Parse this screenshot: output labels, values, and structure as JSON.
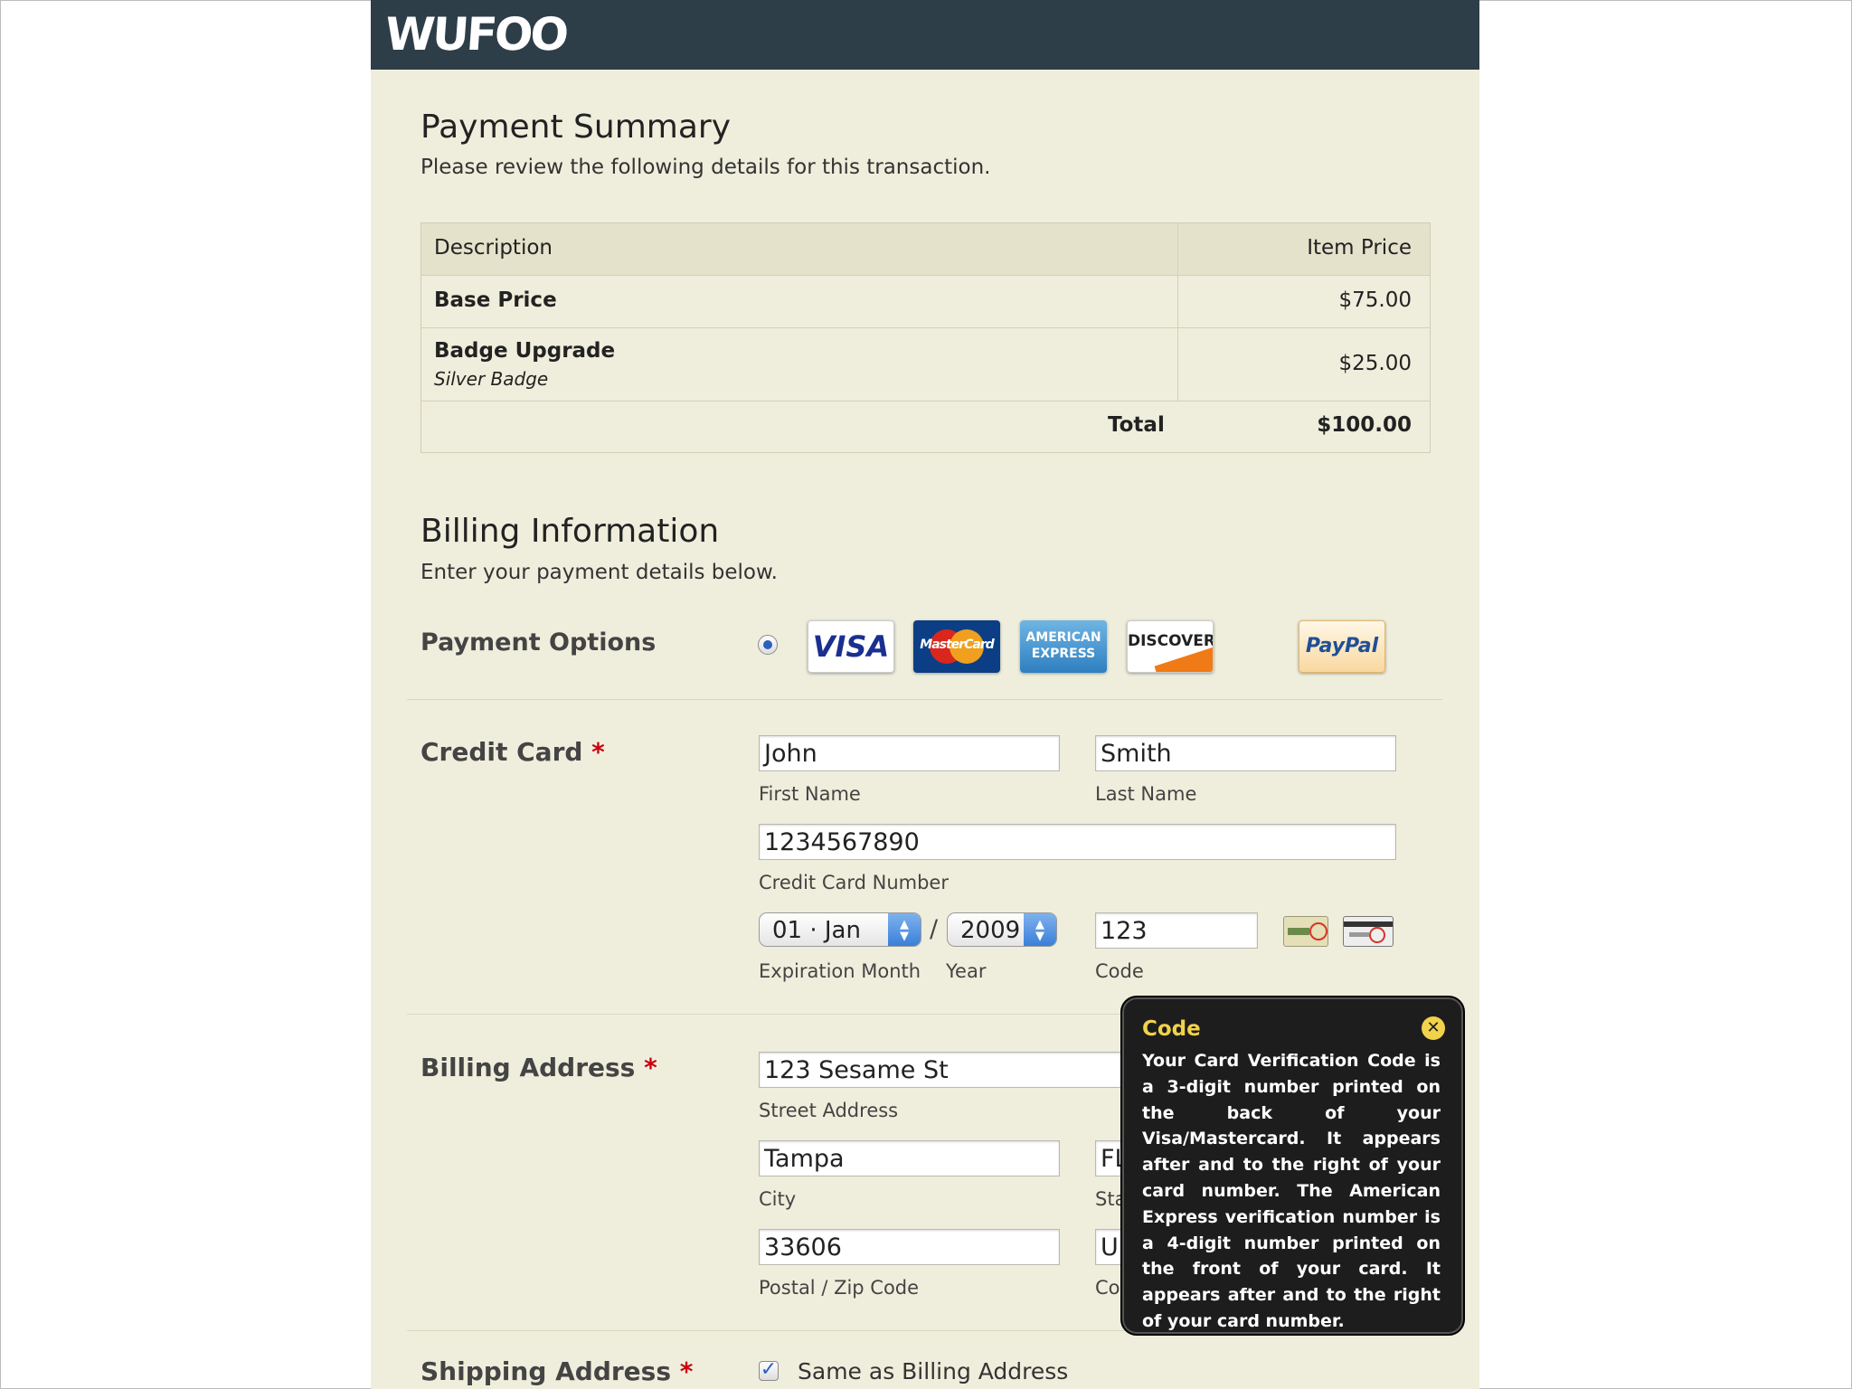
{
  "brand": {
    "logo_text": "WUFOO"
  },
  "summary": {
    "title": "Payment Summary",
    "subtitle": "Please review the following details for this transaction.",
    "columns": [
      "Description",
      "Item Price"
    ],
    "rows": [
      {
        "description": "Base Price",
        "detail": "",
        "price": "$75.00"
      },
      {
        "description": "Badge Upgrade",
        "detail": "Silver Badge",
        "price": "$25.00"
      }
    ],
    "total_label": "Total",
    "total_value": "$100.00"
  },
  "billing": {
    "title": "Billing Information",
    "subtitle": "Enter your payment details below.",
    "payment_options_label": "Payment Options",
    "cards": {
      "visa": "VISA",
      "mastercard": "MasterCard",
      "amex_line1": "AMERICAN",
      "amex_line2": "EXPRESS",
      "discover": "DISCOVER",
      "paypal": "PayPal"
    }
  },
  "credit_card": {
    "label": "Credit Card",
    "required_mark": "*",
    "first_name": {
      "value": "John",
      "label": "First Name"
    },
    "last_name": {
      "value": "Smith",
      "label": "Last Name"
    },
    "card_number": {
      "value": "1234567890",
      "label": "Credit Card Number"
    },
    "exp_month": {
      "value": "01 · Jan",
      "label": "Expiration Month"
    },
    "separator": "/",
    "exp_year": {
      "value": "2009",
      "label": "Year"
    },
    "code": {
      "value": "123",
      "label": "Code"
    }
  },
  "billing_address": {
    "label": "Billing Address",
    "required_mark": "*",
    "street": {
      "value": "123 Sesame St",
      "label": "Street Address"
    },
    "city": {
      "value": "Tampa",
      "label": "City"
    },
    "state": {
      "value": "FL",
      "label": "Sta"
    },
    "zip": {
      "value": "33606",
      "label": "Postal / Zip Code"
    },
    "country": {
      "value": "U",
      "label": "Co"
    }
  },
  "shipping_address": {
    "label": "Shipping Address",
    "required_mark": "*",
    "same_as_billing": {
      "label": "Same as Billing Address",
      "checked": true
    }
  },
  "tooltip": {
    "title": "Code",
    "body": "Your Card Verification Code is a 3-digit number printed on the back of your Visa/Mastercard. It appears after and to the right of your card number. The American Express verification number is a 4-digit number printed on the front of your card. It appears after and to the right of your card number."
  },
  "colors": {
    "header_bg": "#2e3e48",
    "page_bg": "#efeedc",
    "required": "#cc0011",
    "tooltip_bg": "#1d1d1d",
    "tooltip_accent": "#f1d24a"
  }
}
